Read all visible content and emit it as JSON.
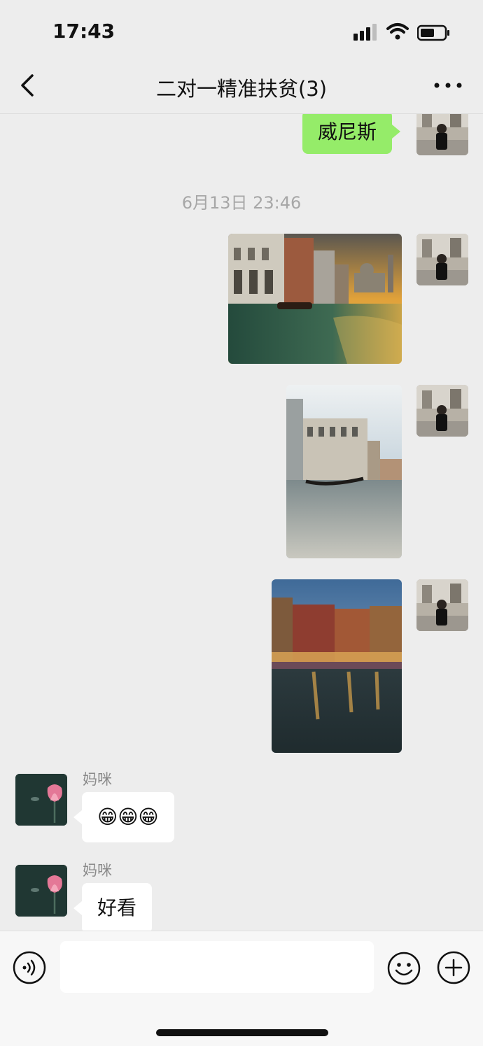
{
  "status_bar": {
    "time": "17:43"
  },
  "nav": {
    "title": "二对一精准扶贫(3)"
  },
  "messages": {
    "self_text": "威尼斯",
    "timestamp": "6月13日 23:46",
    "mom_name_1": "妈咪",
    "mom_emoji": "😁😁😁",
    "mom_name_2": "妈咪",
    "mom_text": "好看"
  },
  "icons": {
    "back": "chevron-left-icon",
    "more": "more-dots-icon",
    "voice": "voice-icon",
    "emoji": "smiley-icon",
    "plus": "plus-icon"
  },
  "colors": {
    "self_bubble": "#95ec69",
    "other_bubble": "#ffffff",
    "background": "#ededed"
  }
}
